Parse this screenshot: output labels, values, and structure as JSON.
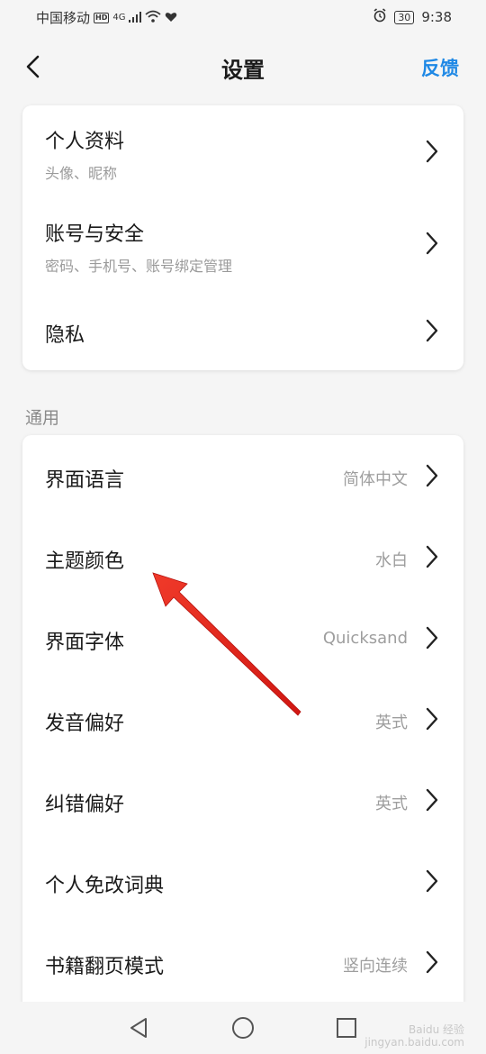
{
  "status_bar": {
    "carrier": "中国移动",
    "hd": "HD",
    "network": "4G",
    "battery": "30",
    "time": "9:38"
  },
  "header": {
    "title": "设置",
    "feedback": "反馈"
  },
  "account_section": {
    "items": [
      {
        "title": "个人资料",
        "subtitle": "头像、昵称"
      },
      {
        "title": "账号与安全",
        "subtitle": "密码、手机号、账号绑定管理"
      },
      {
        "title": "隐私"
      }
    ]
  },
  "general_section": {
    "label": "通用",
    "items": [
      {
        "title": "界面语言",
        "value": "简体中文"
      },
      {
        "title": "主题颜色",
        "value": "水白"
      },
      {
        "title": "界面字体",
        "value": "Quicksand"
      },
      {
        "title": "发音偏好",
        "value": "英式"
      },
      {
        "title": "纠错偏好",
        "value": "英式"
      },
      {
        "title": "个人免改词典"
      },
      {
        "title": "书籍翻页模式",
        "value": "竖向连续"
      }
    ]
  },
  "watermark": {
    "line1": "Baidu 经验",
    "line2": "jingyan.baidu.com"
  },
  "colors": {
    "accent": "#1e88e5",
    "annotation_arrow": "#e8231f",
    "background": "#f5f5f5"
  }
}
